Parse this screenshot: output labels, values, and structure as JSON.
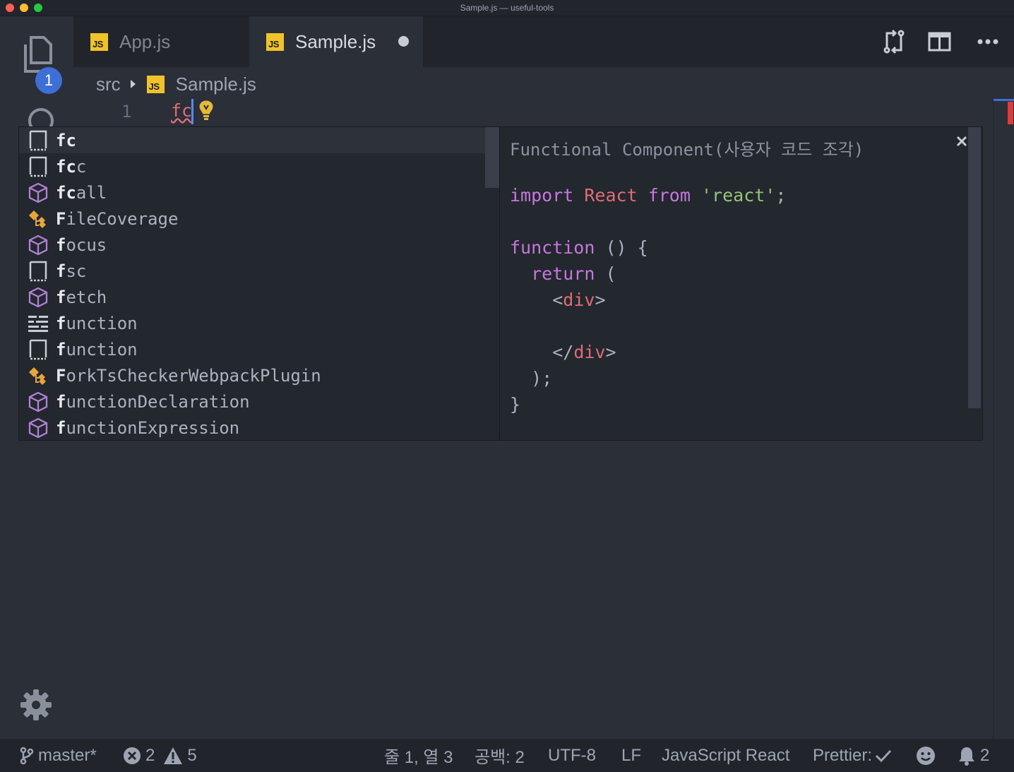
{
  "window": {
    "title": "Sample.js — useful-tools"
  },
  "activity": {
    "explorer_badge": "1"
  },
  "tabs": [
    {
      "label": "App.js",
      "icon": "js-file-icon",
      "badge": "JS",
      "active": false,
      "dirty": false
    },
    {
      "label": "Sample.js",
      "icon": "js-file-icon",
      "badge": "JS",
      "active": true,
      "dirty": true
    }
  ],
  "toolbar": {
    "actions": [
      "source-control-compare-icon",
      "split-editor-icon",
      "more-actions-icon"
    ]
  },
  "breadcrumb": {
    "folder": "src",
    "file": "Sample.js",
    "badge": "JS"
  },
  "editor": {
    "line_number": "1",
    "typed": "fc"
  },
  "suggestions": [
    {
      "match": "fc",
      "rest": "",
      "icon": "snippet-icon"
    },
    {
      "match": "fc",
      "rest": "c",
      "icon": "snippet-icon"
    },
    {
      "match": "fc",
      "rest": "all",
      "icon": "property-cube-icon"
    },
    {
      "match": "F",
      "rest": "ileCoverage",
      "icon": "class-icon"
    },
    {
      "match": "f",
      "rest": "ocus",
      "icon": "property-cube-icon"
    },
    {
      "match": "f",
      "rest": "sc",
      "icon": "snippet-icon"
    },
    {
      "match": "f",
      "rest": "etch",
      "icon": "property-cube-icon"
    },
    {
      "match": "f",
      "rest": "unction",
      "icon": "keyword-icon"
    },
    {
      "match": "f",
      "rest": "unction",
      "icon": "snippet-icon"
    },
    {
      "match": "F",
      "rest": "orkTsCheckerWebpackPlugin",
      "icon": "class-icon"
    },
    {
      "match": "f",
      "rest": "unctionDeclaration",
      "icon": "property-cube-icon"
    },
    {
      "match": "f",
      "rest": "unctionExpression",
      "icon": "property-cube-icon"
    }
  ],
  "details": {
    "header": "Functional Component(사용자 코드 조각)",
    "code": {
      "import_kw": "import",
      "react_id": "React",
      "from_kw": "from",
      "module_str": "'react'",
      "semi": ";",
      "function_kw": "function",
      "parens": "() {",
      "return_kw": "return",
      "open_paren": "(",
      "lt": "<",
      "div_tag": "div",
      "gt": ">",
      "close_lt": "</",
      "close_paren": ");",
      "close_brace": "}"
    }
  },
  "colors": {
    "keyword": "#c678dd",
    "identifier": "#e06c75",
    "string": "#98c379",
    "accent": "#3d6fd6",
    "badge_bg": "#f0c32b"
  },
  "status": {
    "branch": "master*",
    "errors": "2",
    "warnings": "5",
    "position": "줄 1, 열 3",
    "indent": "공백: 2",
    "encoding": "UTF-8",
    "eol": "LF",
    "language": "JavaScript React",
    "formatter": "Prettier:",
    "notifications": "2"
  }
}
